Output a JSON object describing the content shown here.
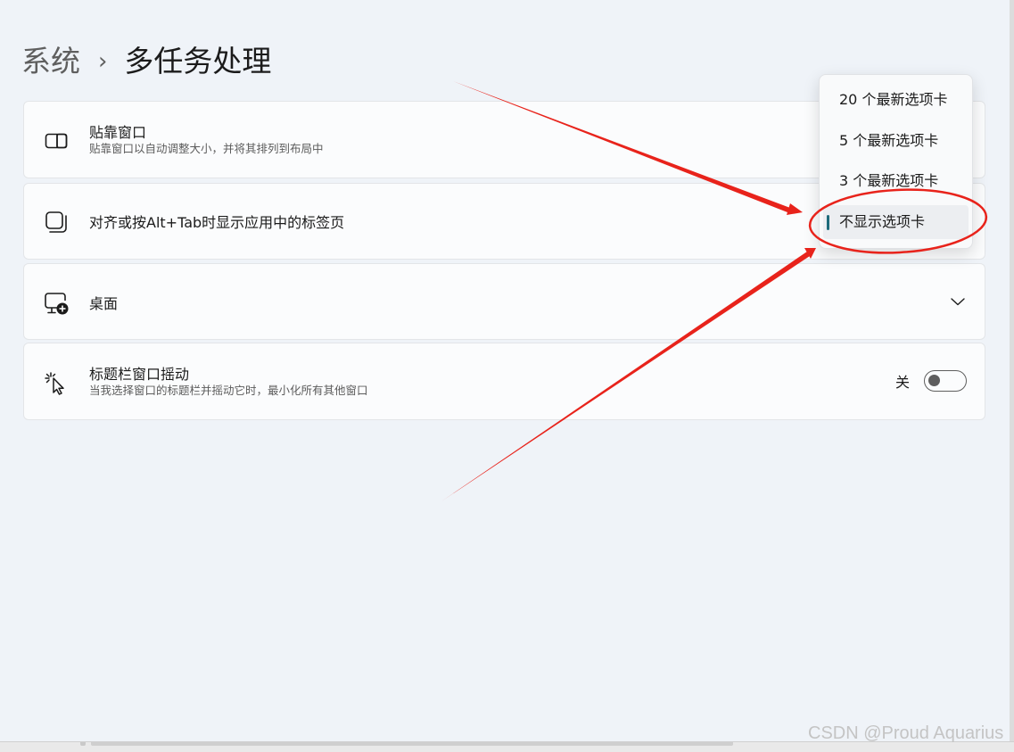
{
  "breadcrumb": {
    "parent": "系统",
    "separator": "›",
    "current": "多任务处理"
  },
  "cards": [
    {
      "title": "贴靠窗口",
      "description": "贴靠窗口以自动调整大小，并将其排列到布局中",
      "icon": "snap-window-icon"
    },
    {
      "title": "对齐或按Alt+Tab时显示应用中的标签页",
      "icon": "tabs-window-icon"
    },
    {
      "title": "桌面",
      "icon": "desktop-add-icon",
      "expander": "chevron-down-icon"
    },
    {
      "title": "标题栏窗口摇动",
      "description": "当我选择窗口的标题栏并摇动它时，最小化所有其他窗口",
      "icon": "cursor-shake-icon",
      "toggle": {
        "state_label": "关",
        "on": false
      }
    }
  ],
  "dropdown": {
    "options": [
      "20 个最新选项卡",
      "5 个最新选项卡",
      "3 个最新选项卡",
      "不显示选项卡"
    ],
    "selected": "不显示选项卡"
  },
  "colors": {
    "background": "#eff3f8",
    "card": "#fbfcfd",
    "accent_indicator": "#1e6b7a",
    "annotation_red": "#e8231b"
  },
  "watermark": "CSDN @Proud Aquarius"
}
